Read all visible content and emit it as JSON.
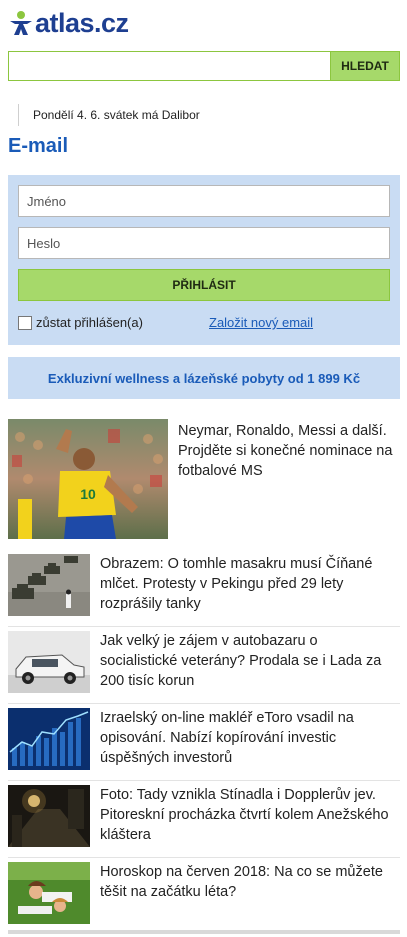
{
  "header": {
    "logo_text": "atlas.cz",
    "brand_color": "#1e3f91"
  },
  "search": {
    "value": "",
    "placeholder": "",
    "button_label": "HLEDAT"
  },
  "nameday": {
    "text": "Pondělí 4. 6. svátek má Dalibor"
  },
  "email_section": {
    "title": "E-mail",
    "name_placeholder": "Jméno",
    "password_placeholder": "Heslo",
    "login_label": "PŘIHLÁSIT",
    "remember_label": "zůstat přihlášen(a)",
    "remember_checked": false,
    "register_label": "Založit nový email"
  },
  "promo": {
    "text": "Exkluzivní wellness a lázeňské pobyty od 1 899 Kč"
  },
  "lead_article": {
    "title": "Neymar, Ronaldo, Messi a další. Projděte si konečné nominace na fotbalové MS",
    "image_icon": "football-player-photo"
  },
  "news": [
    {
      "title": "Obrazem: O tomhle masakru musí Číňané mlčet. Protesty v Pekingu před 29 lety rozprášily tanky",
      "thumb_icon": "tanks-photo"
    },
    {
      "title": "Jak velký je zájem v autobazaru o socialistické veterány? Prodala se i Lada za 200 tisíc korun",
      "thumb_icon": "lada-car-photo"
    },
    {
      "title": "Izraelský on-line makléř eToro vsadil na opisování. Nabízí kopírování investic úspěšných investorů",
      "thumb_icon": "stock-chart-photo"
    },
    {
      "title": "Foto: Tady vznikla Stínadla i Dopplerův jev. Pitoreskní procházka čtvrtí kolem Anežského kláštera",
      "thumb_icon": "night-street-photo"
    },
    {
      "title": "Horoskop na červen 2018: Na co se můžete těšit na začátku léta?",
      "thumb_icon": "women-on-grass-photo"
    }
  ],
  "colors": {
    "accent_green": "#a6d96a",
    "panel_blue": "#c9dcf3",
    "link_blue": "#1a5bb8"
  }
}
